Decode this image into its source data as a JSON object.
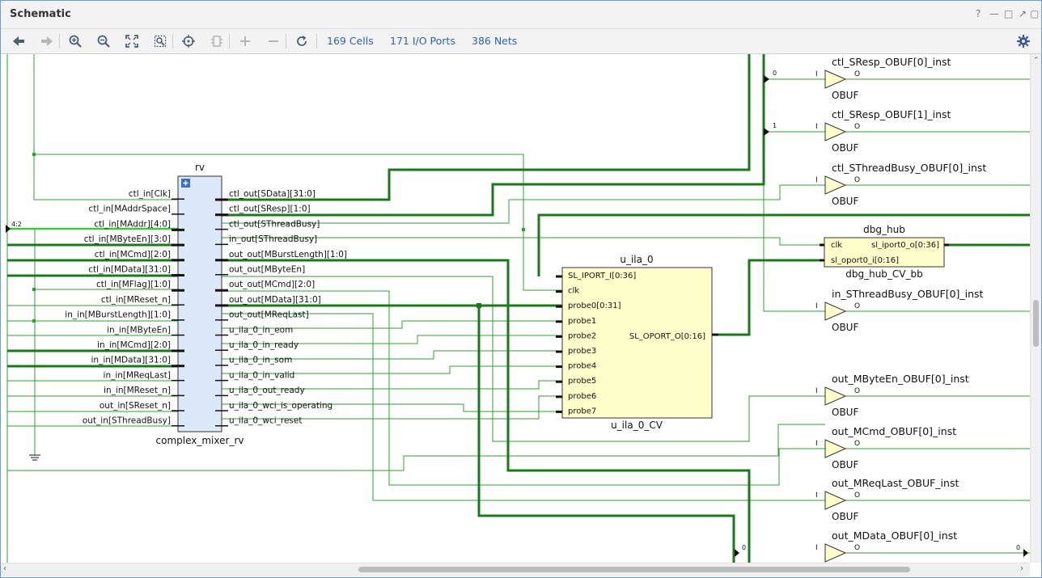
{
  "window": {
    "title": "Schematic"
  },
  "toolbar": {
    "cells": "169 Cells",
    "io_ports": "171 I/O Ports",
    "nets": "386 Nets"
  },
  "rv": {
    "instance": "rv",
    "cell_name": "complex_mixer_rv",
    "inputs": [
      "ctl_in[Clk]",
      "ctl_in[MAddrSpace]",
      "ctl_in[MAddr][4:0]",
      "ctl_in[MByteEn][3:0]",
      "ctl_in[MCmd][2:0]",
      "ctl_in[MData][31:0]",
      "ctl_in[MFlag][1:0]",
      "ctl_in[MReset_n]",
      "in_in[MBurstLength][1:0]",
      "in_in[MByteEn]",
      "in_in[MCmd][2:0]",
      "in_in[MData][31:0]",
      "in_in[MReqLast]",
      "in_in[MReset_n]",
      "out_in[SReset_n]",
      "out_in[SThreadBusy]"
    ],
    "outputs": [
      "ctl_out[SData][31:0]",
      "ctl_out[SResp][1:0]",
      "ctl_out[SThreadBusy]",
      "in_out[SThreadBusy]",
      "out_out[MBurstLength][1:0]",
      "out_out[MByteEn]",
      "out_out[MCmd][2:0]",
      "out_out[MData][31:0]",
      "out_out[MReqLast]",
      "u_ila_0_in_eom",
      "u_ila_0_in_ready",
      "u_ila_0_in_som",
      "u_ila_0_in_valid",
      "u_ila_0_out_ready",
      "u_ila_0_wci_is_operating",
      "u_ila_0_wci_reset"
    ]
  },
  "ila": {
    "instance": "u_ila_0",
    "cell_name": "u_ila_0_CV",
    "inputs": [
      "SL_IPORT_I[0:36]",
      "clk",
      "probe0[0:31]",
      "probe1",
      "probe2",
      "probe3",
      "probe4",
      "probe5",
      "probe6",
      "probe7"
    ],
    "output": "SL_OPORT_O[0:16]"
  },
  "dbg": {
    "instance": "dbg_hub",
    "cell_name": "dbg_hub_CV_bb",
    "in_clk": "clk",
    "in_oport": "sl_oport0_i[0:16]",
    "out_iport": "sl_iport0_o[0:36]"
  },
  "obufs": [
    {
      "inst": "ctl_SResp_OBUF[0]_inst",
      "type": "OBUF",
      "bit": "0"
    },
    {
      "inst": "ctl_SResp_OBUF[1]_inst",
      "type": "OBUF",
      "bit": "1"
    },
    {
      "inst": "ctl_SThreadBusy_OBUF[0]_inst",
      "type": "OBUF",
      "bit": ""
    },
    {
      "inst": "in_SThreadBusy_OBUF[0]_inst",
      "type": "OBUF",
      "bit": ""
    },
    {
      "inst": "out_MByteEn_OBUF[0]_inst",
      "type": "OBUF",
      "bit": ""
    },
    {
      "inst": "out_MCmd_OBUF[0]_inst",
      "type": "OBUF",
      "bit": ""
    },
    {
      "inst": "out_MReqLast_OBUF_inst",
      "type": "OBUF",
      "bit": ""
    },
    {
      "inst": "out_MData_OBUF[0]_inst",
      "type": "OBUF",
      "bit": "0"
    }
  ],
  "pins": {
    "in": "I",
    "out": "O"
  },
  "labels": {
    "bus_42": "4:2",
    "bus_out0": "0"
  }
}
